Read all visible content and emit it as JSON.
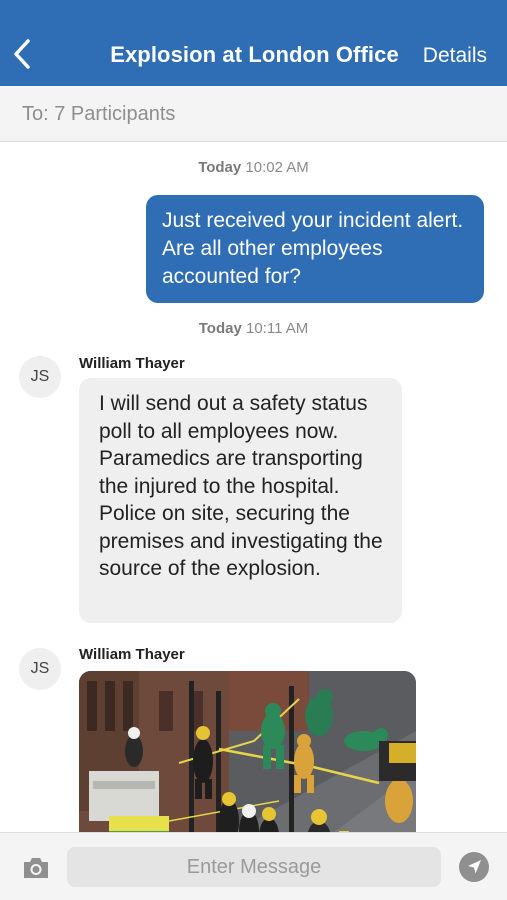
{
  "header": {
    "back_icon": "chevron-left-icon",
    "title": "Explosion at London Office",
    "details_label": "Details",
    "color": "#2f6db5"
  },
  "recipients": {
    "label": "To: 7 Participants"
  },
  "messages": [
    {
      "type": "timestamp",
      "day": "Today",
      "time": "10:02 AM"
    },
    {
      "type": "outgoing",
      "text": "Just received your incident alert. Are all other employees accounted for?"
    },
    {
      "type": "timestamp",
      "day": "Today",
      "time": "10:11 AM"
    },
    {
      "type": "incoming",
      "avatar": "JS",
      "sender": "William Thayer",
      "text": "I will send out a safety status poll to all employees now. Paramedics are transporting the injured to the hospital. Police on site, securing the premises and investigating the source of the explosion."
    },
    {
      "type": "incoming-image",
      "avatar": "JS",
      "sender": "William Thayer",
      "image": "emergency-response-photo"
    }
  ],
  "composer": {
    "camera_icon": "camera-icon",
    "placeholder": "Enter Message",
    "value": "",
    "send_icon": "send-arrow-icon"
  },
  "colors": {
    "outgoing_bubble": "#2f6db5",
    "incoming_bubble": "#efefef"
  }
}
